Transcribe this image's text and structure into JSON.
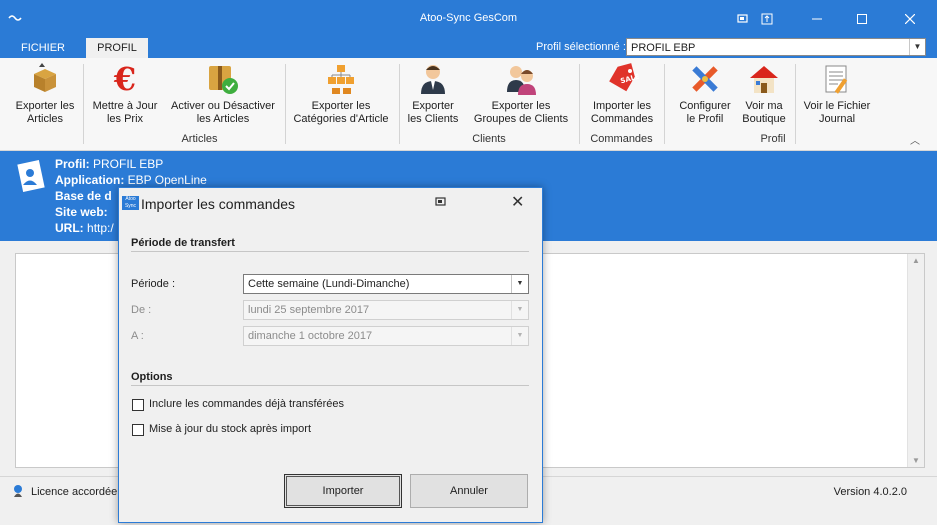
{
  "window": {
    "title": "Atoo-Sync GesCom"
  },
  "menu": {
    "tabs": [
      {
        "label": "FICHIER"
      },
      {
        "label": "PROFIL"
      }
    ],
    "profile_label": "Profil sélectionné :",
    "profile_value": "PROFIL EBP"
  },
  "ribbon": {
    "buttons": [
      {
        "line1": "Exporter les",
        "line2": "Articles",
        "icon": "box-export-icon"
      },
      {
        "line1": "Mettre à Jour",
        "line2": "les Prix",
        "icon": "euro-icon"
      },
      {
        "line1": "Activer ou Désactiver",
        "line2": "les Articles",
        "icon": "box-check-icon"
      },
      {
        "line1": "Exporter les",
        "line2": "Catégories d'Article",
        "icon": "hierarchy-icon"
      },
      {
        "line1": "Exporter",
        "line2": "les Clients",
        "icon": "client-icon"
      },
      {
        "line1": "Exporter les",
        "line2": "Groupes de Clients",
        "icon": "client-group-icon"
      },
      {
        "line1": "Importer les",
        "line2": "Commandes",
        "icon": "sale-tag-icon"
      },
      {
        "line1": "Configurer",
        "line2": "le Profil",
        "icon": "tools-icon"
      },
      {
        "line1": "Voir ma",
        "line2": "Boutique",
        "icon": "house-icon"
      },
      {
        "line1": "Voir le Fichier",
        "line2": "Journal",
        "icon": "journal-icon"
      }
    ],
    "groups": [
      "Articles",
      "Clients",
      "Commandes",
      "Profil"
    ]
  },
  "info": {
    "profil_label": "Profil:",
    "profil_value": "PROFIL EBP",
    "app_label": "Application:",
    "app_value": "EBP OpenLine",
    "base_label": "Base de d",
    "site_label": "Site web:",
    "url_label": "URL:",
    "url_value": "http:/"
  },
  "status": {
    "licence": "Licence accordée à",
    "version": "Version 4.0.2.0"
  },
  "dialog": {
    "title": "Importer les commandes",
    "logo_text": "Atoo Sync",
    "section_transfer": "Période de transfert",
    "periode_label": "Période :",
    "periode_value": "Cette semaine (Lundi-Dimanche)",
    "de_label": "De :",
    "de_value": "lundi 25 septembre 2017",
    "a_label": "A :",
    "a_value": "dimanche 1 octobre 2017",
    "section_options": "Options",
    "opt1": "Inclure les commandes déjà transférées",
    "opt2": "Mise à jour du stock après import",
    "btn_import": "Importer",
    "btn_cancel": "Annuler"
  },
  "colors": {
    "accent": "#2b7bd6"
  }
}
